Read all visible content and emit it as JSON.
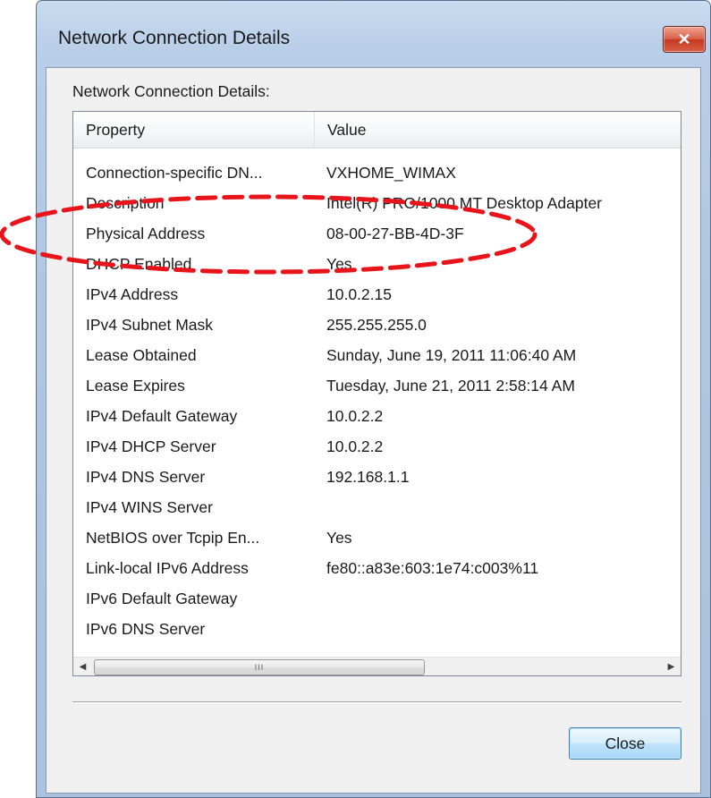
{
  "window": {
    "title": "Network Connection Details",
    "close_glyph": "✕"
  },
  "section_label": "Network Connection Details:",
  "list": {
    "columns": [
      "Property",
      "Value"
    ],
    "rows": [
      {
        "property": "Connection-specific DN...",
        "value": "VXHOME_WIMAX"
      },
      {
        "property": "Description",
        "value": "Intel(R) PRO/1000 MT Desktop Adapter"
      },
      {
        "property": "Physical Address",
        "value": "08-00-27-BB-4D-3F"
      },
      {
        "property": "DHCP Enabled",
        "value": "Yes"
      },
      {
        "property": "IPv4 Address",
        "value": "10.0.2.15"
      },
      {
        "property": "IPv4 Subnet Mask",
        "value": "255.255.255.0"
      },
      {
        "property": "Lease Obtained",
        "value": "Sunday, June 19, 2011 11:06:40 AM"
      },
      {
        "property": "Lease Expires",
        "value": "Tuesday, June 21, 2011 2:58:14 AM"
      },
      {
        "property": "IPv4 Default Gateway",
        "value": "10.0.2.2"
      },
      {
        "property": "IPv4 DHCP Server",
        "value": "10.0.2.2"
      },
      {
        "property": "IPv4 DNS Server",
        "value": "192.168.1.1"
      },
      {
        "property": "IPv4 WINS Server",
        "value": ""
      },
      {
        "property": "NetBIOS over Tcpip En...",
        "value": "Yes"
      },
      {
        "property": "Link-local IPv6 Address",
        "value": "fe80::a83e:603:1e74:c003%11"
      },
      {
        "property": "IPv6 Default Gateway",
        "value": ""
      },
      {
        "property": "IPv6 DNS Server",
        "value": ""
      }
    ]
  },
  "scrollbar": {
    "left_arrow": "◀",
    "right_arrow": "▶",
    "thumb_grip": "III"
  },
  "buttons": {
    "close_label": "Close"
  },
  "annotation": {
    "shape": "dashed-ellipse",
    "color": "#e8141b",
    "highlights_row": "Physical Address"
  }
}
